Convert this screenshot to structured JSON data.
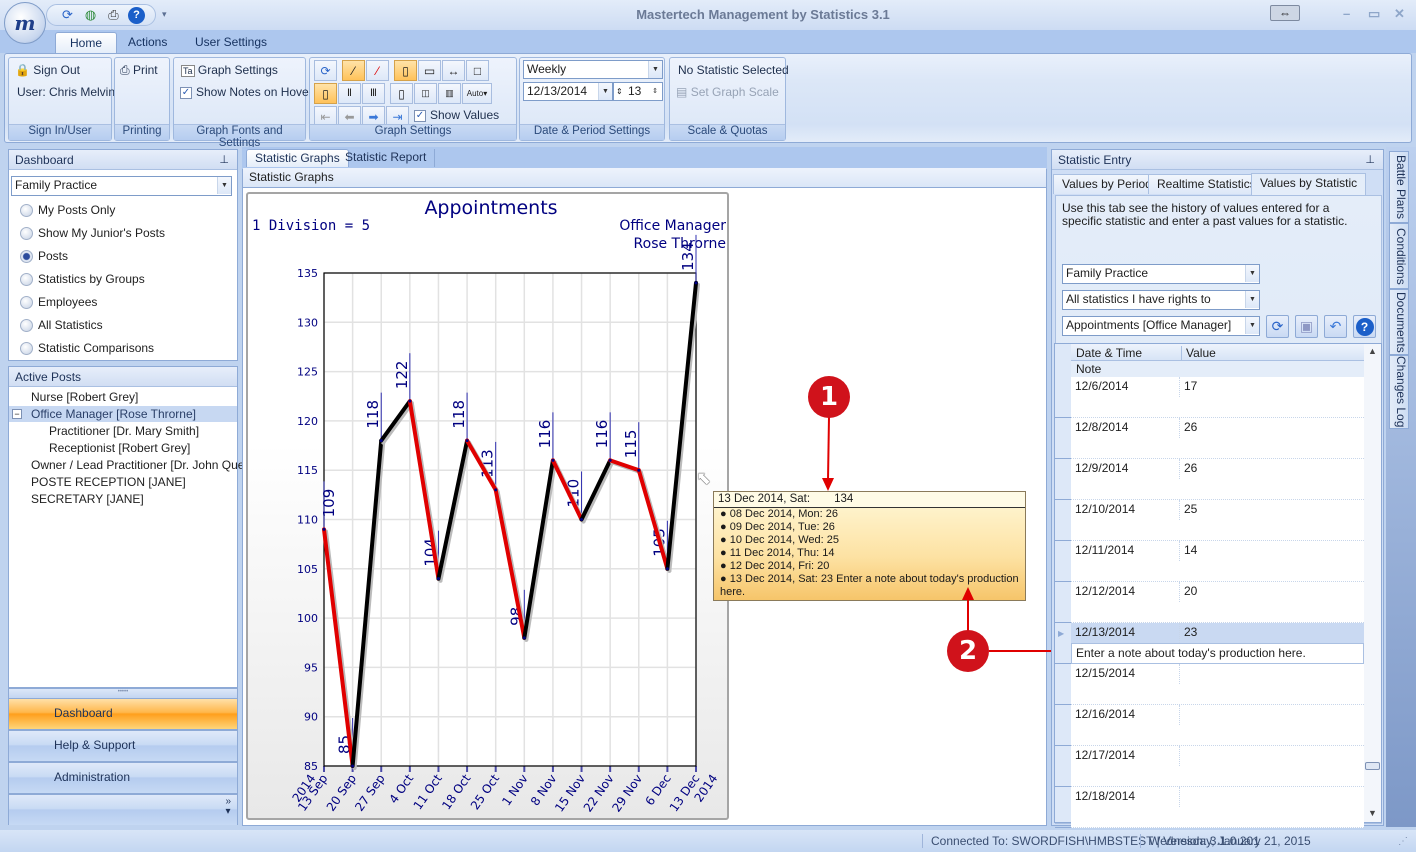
{
  "window": {
    "title": "Mastertech Management by Statistics 3.1",
    "logo_letter": "m"
  },
  "quick_access": [
    "refresh-icon",
    "globe-icon",
    "print-icon",
    "help-icon"
  ],
  "ribbon": {
    "tabs": [
      {
        "label": "Home",
        "active": true
      },
      {
        "label": "Actions"
      },
      {
        "label": "User Settings"
      }
    ],
    "sign_in": {
      "sign_out": "Sign Out",
      "user": "User: Chris Melvin",
      "group": "Sign In/User"
    },
    "printing": {
      "print": "Print",
      "group": "Printing"
    },
    "graph_fonts": {
      "graph_settings": "Graph Settings",
      "show_notes": "Show Notes on Hover",
      "show_notes_checked": true,
      "group": "Graph Fonts and Settings"
    },
    "graph_settings": {
      "show_values": "Show Values",
      "show_values_checked": true,
      "group": "Graph Settings"
    },
    "date_period": {
      "period": "Weekly",
      "date": "12/13/2014",
      "count": "13",
      "group": "Date & Period Settings"
    },
    "scale": {
      "status": "No Statistic Selected",
      "set_scale": "Set Graph Scale",
      "group": "Scale & Quotas"
    }
  },
  "dashboard": {
    "title": "Dashboard",
    "org": "Family Practice",
    "options": [
      {
        "label": "My Posts Only",
        "selected": false
      },
      {
        "label": "Show My Junior's Posts",
        "selected": false
      },
      {
        "label": "Posts",
        "selected": true
      },
      {
        "label": "Statistics by Groups",
        "selected": false
      },
      {
        "label": "Employees",
        "selected": false
      },
      {
        "label": "All Statistics",
        "selected": false
      },
      {
        "label": "Statistic Comparisons",
        "selected": false
      }
    ]
  },
  "active_posts": {
    "title": "Active Posts",
    "items": [
      {
        "label": "Nurse [Robert Grey]",
        "level": 0
      },
      {
        "label": "Office Manager [Rose Throrne]",
        "level": 0,
        "selected": true,
        "expanded": true
      },
      {
        "label": "Practitioner  [Dr. Mary Smith]",
        "level": 1
      },
      {
        "label": "Receptionist  [Robert Grey]",
        "level": 1
      },
      {
        "label": "Owner / Lead Practitioner  [Dr. John Que]",
        "level": 0
      },
      {
        "label": "POSTE RECEPTION [JANE]",
        "level": 0
      },
      {
        "label": "SECRETARY [JANE]",
        "level": 0
      }
    ]
  },
  "nav": [
    {
      "label": "Dashboard",
      "active": true
    },
    {
      "label": "Help & Support"
    },
    {
      "label": "Administration"
    }
  ],
  "graph_tabs": [
    {
      "label": "Statistic Graphs",
      "active": true
    },
    {
      "label": "Statistic Report"
    }
  ],
  "graph_header": "Statistic Graphs",
  "chart_data": {
    "type": "line",
    "title": "Appointments",
    "subtitle_left": "1 Division = 5",
    "subtitle_right": [
      "Office Manager",
      "Rose Throrne"
    ],
    "categories": [
      "13 Sep",
      "20 Sep",
      "27 Sep",
      "4 Oct",
      "11 Oct",
      "18 Oct",
      "25 Oct",
      "1 Nov",
      "8 Nov",
      "15 Nov",
      "22 Nov",
      "29 Nov",
      "6 Dec",
      "13 Dec"
    ],
    "year_start": "2014",
    "year_end": "2014",
    "values": [
      109,
      85,
      118,
      122,
      104,
      118,
      113,
      98,
      116,
      110,
      116,
      115,
      105,
      134
    ],
    "ylim": [
      85,
      135
    ],
    "yticks": [
      85,
      90,
      95,
      100,
      105,
      110,
      115,
      120,
      125,
      130,
      135
    ],
    "up_color": "#000000",
    "down_color": "#e00000",
    "label_color": "#000080",
    "grid": true
  },
  "tooltip": {
    "header_date": "13 Dec 2014, Sat:",
    "header_value": "134",
    "lines": [
      "08 Dec 2014, Mon: 26",
      "09 Dec 2014, Tue: 26",
      "10 Dec 2014, Wed: 25",
      "11 Dec 2014, Thu: 14",
      "12 Dec 2014, Fri: 20",
      "13 Dec 2014, Sat: 23  Enter a note about today's production here."
    ]
  },
  "annotations": [
    "1",
    "2"
  ],
  "stat_entry": {
    "title": "Statistic Entry",
    "tabs": [
      {
        "label": "Values by Period"
      },
      {
        "label": "Realtime Statistics"
      },
      {
        "label": "Values by Statistic",
        "active": true
      }
    ],
    "description": "Use this tab see the history of values entered for a specific statistic and enter a past values for a statistic.",
    "org": "Family Practice",
    "filter": "All statistics I have rights to",
    "statistic": "Appointments [Office Manager]",
    "columns": {
      "date": "Date & Time",
      "value": "Value",
      "note": "Note"
    },
    "rows": [
      {
        "date": "12/6/2014",
        "value": "17",
        "note": ""
      },
      {
        "date": "12/8/2014",
        "value": "26",
        "note": ""
      },
      {
        "date": "12/9/2014",
        "value": "26",
        "note": ""
      },
      {
        "date": "12/10/2014",
        "value": "25",
        "note": ""
      },
      {
        "date": "12/11/2014",
        "value": "14",
        "note": ""
      },
      {
        "date": "12/12/2014",
        "value": "20",
        "note": ""
      },
      {
        "date": "12/13/2014",
        "value": "23",
        "note": "Enter a note about today's production here.",
        "selected": true
      },
      {
        "date": "12/15/2014",
        "value": "",
        "note": ""
      },
      {
        "date": "12/16/2014",
        "value": "",
        "note": ""
      },
      {
        "date": "12/17/2014",
        "value": "",
        "note": ""
      },
      {
        "date": "12/18/2014",
        "value": "",
        "note": ""
      }
    ]
  },
  "side_tabs": [
    "Battle Plans",
    "Conditions",
    "Documents",
    "Changes Log"
  ],
  "status": {
    "connection": "Connected To: SWORDFISH\\HMBSTEST | Version: 3.1.0.201",
    "date": "Wednesday, January 21, 2015"
  }
}
